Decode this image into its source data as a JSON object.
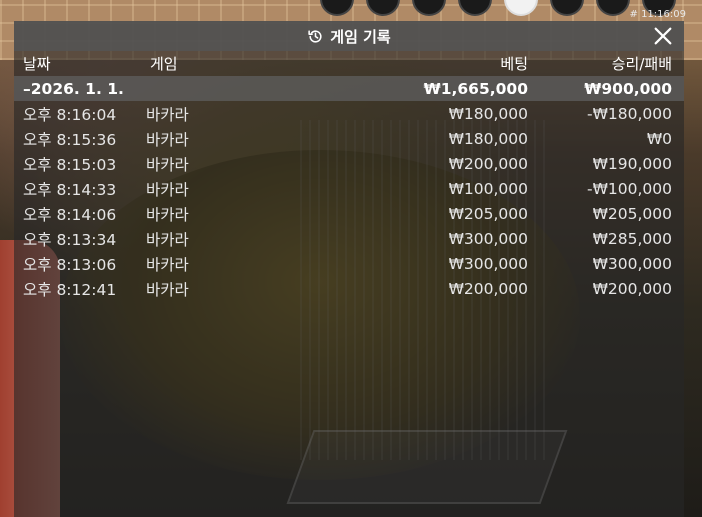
{
  "timestamp": "# 11:16:09",
  "panel": {
    "title": "게임 기록",
    "icons": {
      "title": "history-icon",
      "close": "close-icon"
    }
  },
  "columns": {
    "date": "날짜",
    "game": "게임",
    "bet": "베팅",
    "result": "승리/패배"
  },
  "summary": {
    "date": "–2026. 1. 1.",
    "game": "",
    "bet": "₩1,665,000",
    "result": "₩900,000"
  },
  "rows": [
    {
      "time": "오후 8:16:04",
      "game": "바카라",
      "bet": "₩180,000",
      "result": "-₩180,000"
    },
    {
      "time": "오후 8:15:36",
      "game": "바카라",
      "bet": "₩180,000",
      "result": "₩0"
    },
    {
      "time": "오후 8:15:03",
      "game": "바카라",
      "bet": "₩200,000",
      "result": "₩190,000"
    },
    {
      "time": "오후 8:14:33",
      "game": "바카라",
      "bet": "₩100,000",
      "result": "-₩100,000"
    },
    {
      "time": "오후 8:14:06",
      "game": "바카라",
      "bet": "₩205,000",
      "result": "₩205,000"
    },
    {
      "time": "오후 8:13:34",
      "game": "바카라",
      "bet": "₩300,000",
      "result": "₩285,000"
    },
    {
      "time": "오후 8:13:06",
      "game": "바카라",
      "bet": "₩300,000",
      "result": "₩300,000"
    },
    {
      "time": "오후 8:12:41",
      "game": "바카라",
      "bet": "₩200,000",
      "result": "₩200,000"
    }
  ]
}
